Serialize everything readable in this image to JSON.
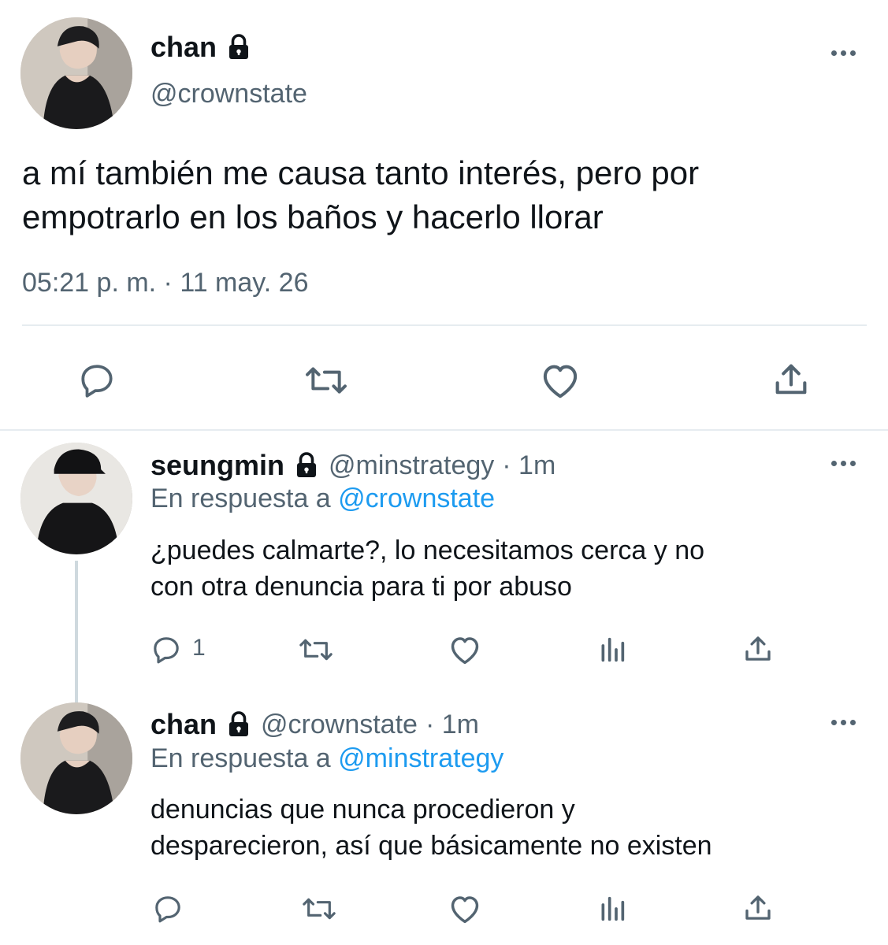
{
  "main_tweet": {
    "author": {
      "name": "chan",
      "handle": "@crownstate"
    },
    "text_line1": "a mí también me causa tanto interés, pero por",
    "text_line2": "empotrarlo en los baños y hacerlo llorar",
    "timestamp": "05:21 p. m. · 11 may. 26",
    "actions": [
      "reply-icon",
      "retweet-icon",
      "like-icon",
      "share-icon"
    ]
  },
  "replies": [
    {
      "name": "seungmin",
      "handle": "@minstrategy",
      "time": "· 1m",
      "reply_prefix": "En respuesta a",
      "reply_to": "@crownstate",
      "text_line1": "¿puedes calmarte?, lo necesitamos cerca y no",
      "text_line2": "con otra denuncia para ti por abuso",
      "reply_count": "1"
    },
    {
      "name": "chan",
      "handle": "@crownstate",
      "time": "· 1m",
      "reply_prefix": "En respuesta a",
      "reply_to": "@minstrategy",
      "text_line1": "denuncias que nunca procedieron y",
      "text_line2": "desparecieron, así que básicamente no existen",
      "reply_count": ""
    }
  ],
  "colors": {
    "text": "#0f1419",
    "secondary": "#536471",
    "link": "#1d9bf0",
    "divider": "#e6ecf0"
  }
}
